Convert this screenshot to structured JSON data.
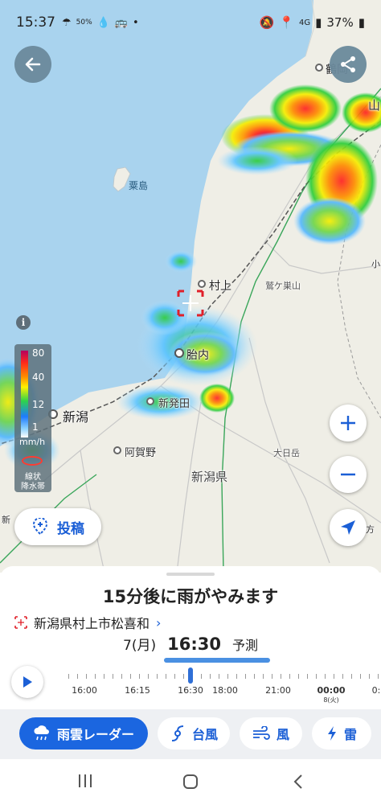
{
  "status_bar": {
    "time": "15:37",
    "rain_chance": "50%",
    "network": "4G",
    "battery": "37%"
  },
  "map": {
    "labels": {
      "tsuruoka": "鶴岡",
      "yama": "山",
      "awashima": "粟島",
      "murakami": "村上",
      "takanosuyama": "鷲ケ巣山",
      "tainai": "胎内",
      "shibata": "新発田",
      "niigata": "新潟",
      "agano": "阿賀野",
      "odaizan": "大日岳",
      "niigata_pref": "新潟県",
      "ko": "小",
      "kata": "方",
      "shin_left": "新"
    },
    "legend": {
      "ticks": [
        "80",
        "40",
        "12",
        "1"
      ],
      "unit": "mm/h",
      "band_line1": "線状",
      "band_line2": "降水帯"
    },
    "post_label": "投稿"
  },
  "sheet": {
    "headline": "15分後に雨がやみます",
    "location": "新潟県村上市松喜和",
    "date": "7(月)",
    "clock": "16:30",
    "forecast": "予測",
    "timeline_labels": [
      "16:00",
      "16:15",
      "16:30",
      "18:00",
      "21:00",
      "00:00"
    ],
    "timeline_sub": "8(火)",
    "timeline_edge": "0:"
  },
  "modes": {
    "radar": "雨雲レーダー",
    "typhoon": "台風",
    "wind": "風",
    "thunder": "雷"
  },
  "colors": {
    "accent": "#1b66e0",
    "sea": "#a9d3ee",
    "land": "#efeee6"
  }
}
